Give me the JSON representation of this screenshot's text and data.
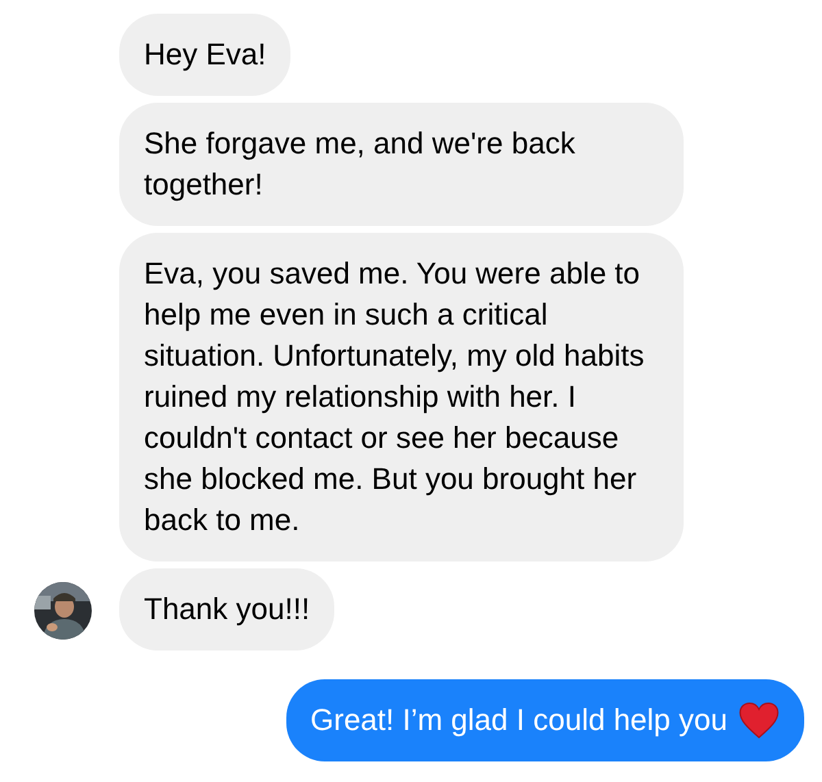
{
  "messages": [
    {
      "kind": "received",
      "text": "Hey Eva!",
      "avatar": false
    },
    {
      "kind": "received",
      "text": "She forgave me, and we're back together!",
      "avatar": false
    },
    {
      "kind": "received",
      "text": "Eva, you saved me. You were able to help me even in such a critical situation. Unfortunately, my old habits ruined my relationship with her. I couldn't contact or see her because she blocked me. But you brought her back to me.",
      "avatar": false
    },
    {
      "kind": "received",
      "text": "Thank you!!!",
      "avatar": true
    },
    {
      "kind": "sent",
      "text": "Great! I’m glad I could help you"
    }
  ]
}
